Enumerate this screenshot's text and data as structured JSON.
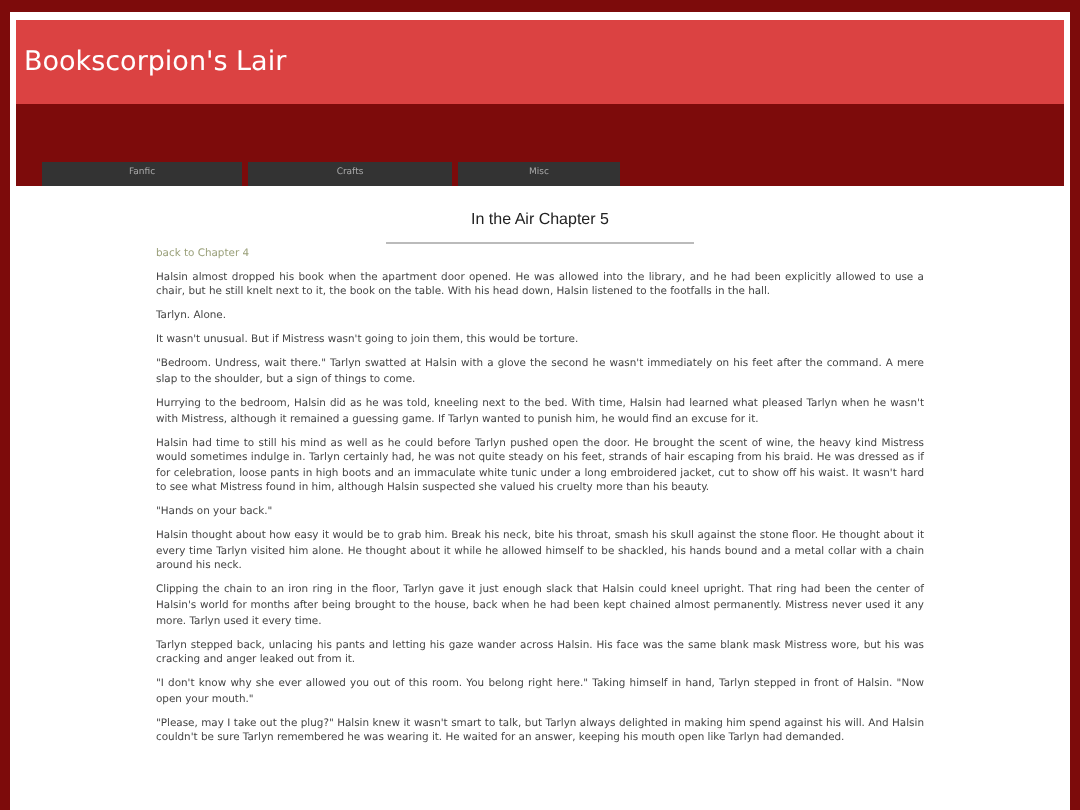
{
  "site_title": "Bookscorpion's Lair",
  "nav": [
    {
      "label": "Fanfic"
    },
    {
      "label": "Crafts"
    },
    {
      "label": "Misc"
    }
  ],
  "page_title": "In the Air Chapter 5",
  "back_link": "back to Chapter 4",
  "paragraphs": [
    "Halsin almost dropped his book when the apartment door opened. He was allowed into the library, and he had been explicitly allowed to use a chair, but he still knelt next to it, the book on the table. With his head down, Halsin listened to the footfalls in the hall.",
    "Tarlyn. Alone.",
    "It wasn't unusual. But if Mistress wasn't going to join them, this would be torture.",
    "\"Bedroom. Undress, wait there.\" Tarlyn swatted at Halsin with a glove the second he wasn't immediately on his feet after the command. A mere slap to the shoulder, but a sign of things to come.",
    "Hurrying to the bedroom, Halsin did as he was told, kneeling next to the bed. With time, Halsin had learned what pleased Tarlyn when he wasn't with Mistress, although it remained a guessing game. If Tarlyn wanted to punish him, he would find an excuse for it.",
    "Halsin had time to still his mind as well as he could before Tarlyn pushed open the door. He brought the scent of wine, the heavy kind Mistress would sometimes indulge in. Tarlyn certainly had, he was not quite steady on his feet, strands of hair escaping from his braid. He was dressed as if for celebration, loose pants in high boots and an immaculate white tunic under a long embroidered jacket, cut to show off his waist. It wasn't hard to see what Mistress found in him, although Halsin suspected she valued his cruelty more than his beauty.",
    "\"Hands on your back.\"",
    "Halsin thought about how easy it would be to grab him. Break his neck, bite his throat, smash his skull against the stone floor. He thought about it every time Tarlyn visited him alone. He thought about it while he allowed himself to be shackled, his hands bound and a metal collar with a chain around his neck.",
    "Clipping the chain to an iron ring in the floor, Tarlyn gave it just enough slack that Halsin could kneel upright. That ring had been the center of Halsin's world for months after being brought to the house, back when he had been kept chained almost permanently. Mistress never used it any more. Tarlyn used it every time.",
    "Tarlyn stepped back, unlacing his pants and letting his gaze wander across Halsin. His face was the same blank mask Mistress wore, but his was cracking and anger leaked out from it.",
    "\"I don't know why she ever allowed you out of this room. You belong right here.\" Taking himself in hand, Tarlyn stepped in front of Halsin. \"Now open your mouth.\"",
    "\"Please, may I take out the plug?\" Halsin knew it wasn't smart to talk, but Tarlyn always delighted in making him spend against his will. And Halsin couldn't be sure Tarlyn remembered he was wearing it. He waited for an answer, keeping his mouth open like Tarlyn had demanded."
  ]
}
